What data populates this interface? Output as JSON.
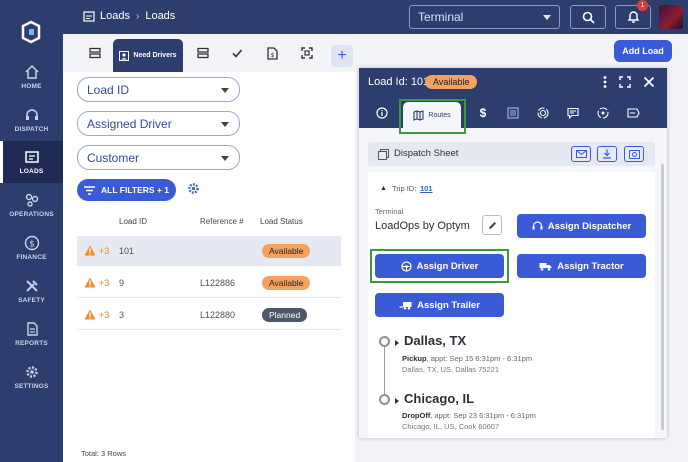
{
  "nav": {
    "items": [
      {
        "label": "HOME",
        "icon": "home-icon"
      },
      {
        "label": "DISPATCH",
        "icon": "headset-icon"
      },
      {
        "label": "LOADS",
        "icon": "loads-icon"
      },
      {
        "label": "OPERATIONS",
        "icon": "operations-icon"
      },
      {
        "label": "FINANCE",
        "icon": "dollar-icon"
      },
      {
        "label": "SAFETY",
        "icon": "tools-icon"
      },
      {
        "label": "REPORTS",
        "icon": "report-icon"
      },
      {
        "label": "SETTINGS",
        "icon": "gear-icon"
      }
    ],
    "active": "LOADS"
  },
  "header": {
    "breadcrumb_root": "Loads",
    "breadcrumb_current": "Loads",
    "terminal_value": "Terminal",
    "notification_count": "1",
    "add_load_label": "Add Load"
  },
  "tabs": {
    "active_label": "Need Drivers"
  },
  "filters": {
    "load_id": "Load ID",
    "assigned_driver": "Assigned Driver",
    "customer": "Customer",
    "all_filters": "ALL FILTERS + 1"
  },
  "table": {
    "headers": [
      "Load ID",
      "Reference #",
      "Load Status"
    ],
    "rows": [
      {
        "warn": "+3",
        "load_id": "101",
        "reference": "",
        "status": "Available"
      },
      {
        "warn": "+3",
        "load_id": "9",
        "reference": "L122886",
        "status": "Available"
      },
      {
        "warn": "+3",
        "load_id": "3",
        "reference": "L122880",
        "status": "Planned"
      }
    ],
    "total": "Total: 3 Rows"
  },
  "detail": {
    "title": "Load Id: 101",
    "status": "Available",
    "routes_tab": "Routes",
    "dispatch_sheet": "Dispatch Sheet",
    "trip_label": "Trip ID:",
    "trip_id": "101",
    "terminal_label": "Terminal",
    "terminal_value": "LoadOps by Optym",
    "assign_dispatcher": "Assign Dispatcher",
    "assign_driver": "Assign Driver",
    "assign_tractor": "Assign Tractor",
    "assign_trailer": "Assign Trailer",
    "stops": [
      {
        "city": "Dallas, TX",
        "type": "Pickup",
        "appt": ", appt: Sep 15 6:31pm - 6:31pm",
        "address": "Dallas, TX, US, Dallas 75221"
      },
      {
        "city": "Chicago, IL",
        "type": "DropOff",
        "appt": ", appt: Sep 23 6:31pm - 6:31pm",
        "address": "Chicago, IL, US, Cook 60607"
      }
    ]
  },
  "colors": {
    "nav_bg": "#2d3d6e",
    "primary": "#3b5bd6",
    "available": "#f4a261",
    "planned": "#4d5769",
    "highlight": "#3c9a3c"
  }
}
